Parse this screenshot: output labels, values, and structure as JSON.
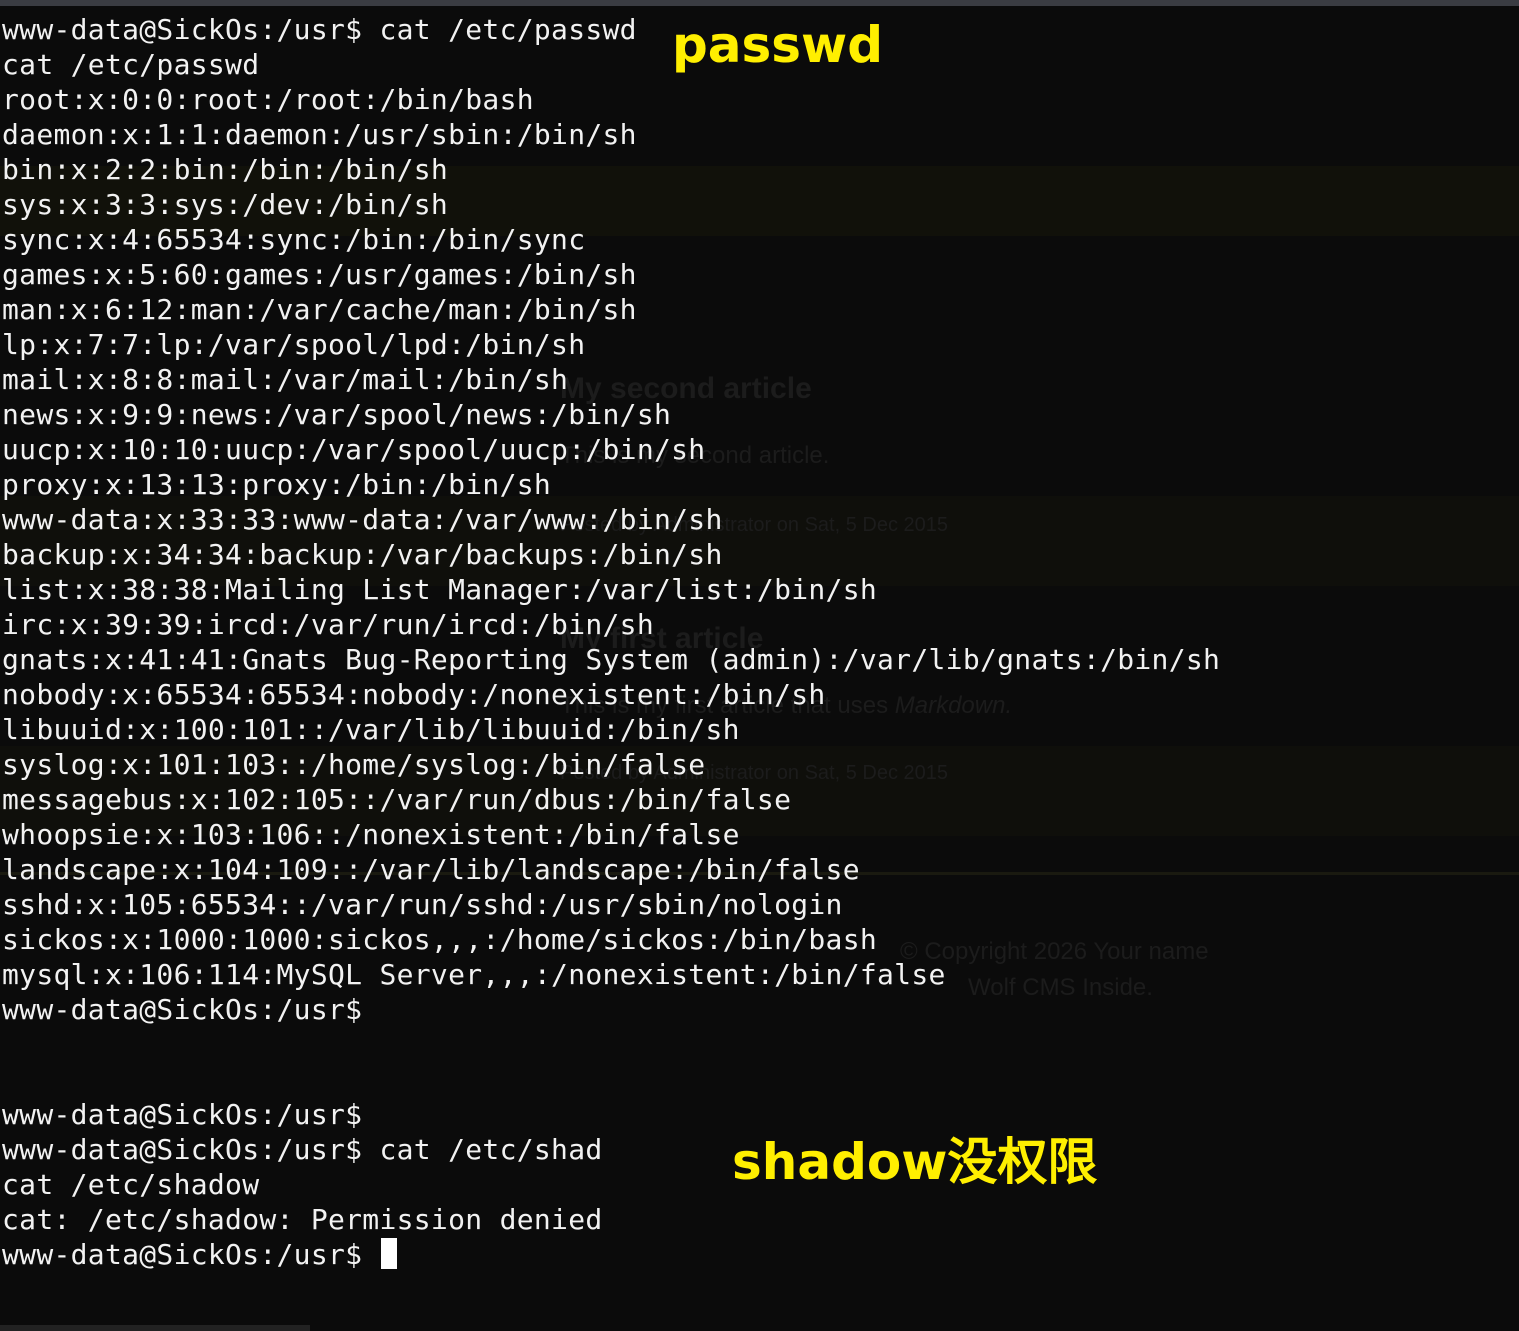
{
  "annotations": {
    "passwd_label": "passwd",
    "shadow_label": "shadow没权限"
  },
  "terminal": {
    "lines": [
      "www-data@SickOs:/usr$ cat /etc/passwd",
      "cat /etc/passwd",
      "root:x:0:0:root:/root:/bin/bash",
      "daemon:x:1:1:daemon:/usr/sbin:/bin/sh",
      "bin:x:2:2:bin:/bin:/bin/sh",
      "sys:x:3:3:sys:/dev:/bin/sh",
      "sync:x:4:65534:sync:/bin:/bin/sync",
      "games:x:5:60:games:/usr/games:/bin/sh",
      "man:x:6:12:man:/var/cache/man:/bin/sh",
      "lp:x:7:7:lp:/var/spool/lpd:/bin/sh",
      "mail:x:8:8:mail:/var/mail:/bin/sh",
      "news:x:9:9:news:/var/spool/news:/bin/sh",
      "uucp:x:10:10:uucp:/var/spool/uucp:/bin/sh",
      "proxy:x:13:13:proxy:/bin:/bin/sh",
      "www-data:x:33:33:www-data:/var/www:/bin/sh",
      "backup:x:34:34:backup:/var/backups:/bin/sh",
      "list:x:38:38:Mailing List Manager:/var/list:/bin/sh",
      "irc:x:39:39:ircd:/var/run/ircd:/bin/sh",
      "gnats:x:41:41:Gnats Bug-Reporting System (admin):/var/lib/gnats:/bin/sh",
      "nobody:x:65534:65534:nobody:/nonexistent:/bin/sh",
      "libuuid:x:100:101::/var/lib/libuuid:/bin/sh",
      "syslog:x:101:103::/home/syslog:/bin/false",
      "messagebus:x:102:105::/var/run/dbus:/bin/false",
      "whoopsie:x:103:106::/nonexistent:/bin/false",
      "landscape:x:104:109::/var/lib/landscape:/bin/false",
      "sshd:x:105:65534::/var/run/sshd:/usr/sbin/nologin",
      "sickos:x:1000:1000:sickos,,,:/home/sickos:/bin/bash",
      "mysql:x:106:114:MySQL Server,,,:/nonexistent:/bin/false",
      "www-data@SickOs:/usr$",
      "",
      "",
      "www-data@SickOs:/usr$",
      "www-data@SickOs:/usr$ cat /etc/shad",
      "cat /etc/shadow",
      "cat: /etc/shadow: Permission denied",
      "www-data@SickOs:/usr$ "
    ]
  },
  "background_page": {
    "heading_1": "My second article",
    "text_1": "This is my second article.",
    "meta_1": "Posted by Administrator on Sat, 5 Dec 2015",
    "heading_2": "My first article",
    "text_2": "This is my first article that uses",
    "text_2_em": "Markdown.",
    "meta_2": "Posted by Administrator on Sat, 5 Dec 2015",
    "footer_1": "© Copyright 2026 Your name",
    "footer_2": "Wolf CMS Inside."
  },
  "colors": {
    "terminal_bg": "#0b0b0b",
    "terminal_fg": "#f2f2f2",
    "annotation": "#ffef00"
  }
}
